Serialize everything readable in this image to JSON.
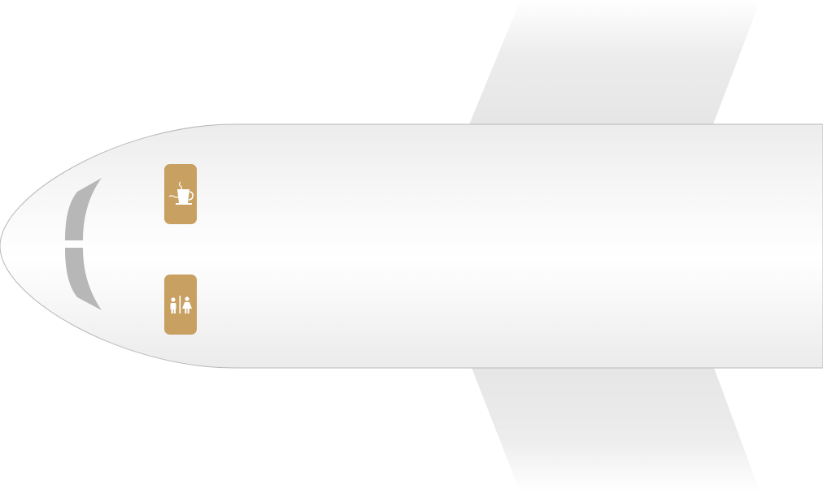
{
  "seat_map": {
    "amenities": [
      {
        "name": "galley",
        "icon": "galley-coffee-icon",
        "color": "#c7a062"
      },
      {
        "name": "lavatory",
        "icon": "lavatory-icon",
        "color": "#c7a062"
      }
    ],
    "colors": {
      "fuselage_edge": "#f0f0f0",
      "fuselage_center": "#ffffff",
      "fuselage_outline": "#b8b8b8",
      "wing": "#e8e8e8",
      "windshield": "#b7b7b7",
      "amenity_badge": "#c7a062",
      "amenity_glyph": "#ffffff"
    }
  }
}
